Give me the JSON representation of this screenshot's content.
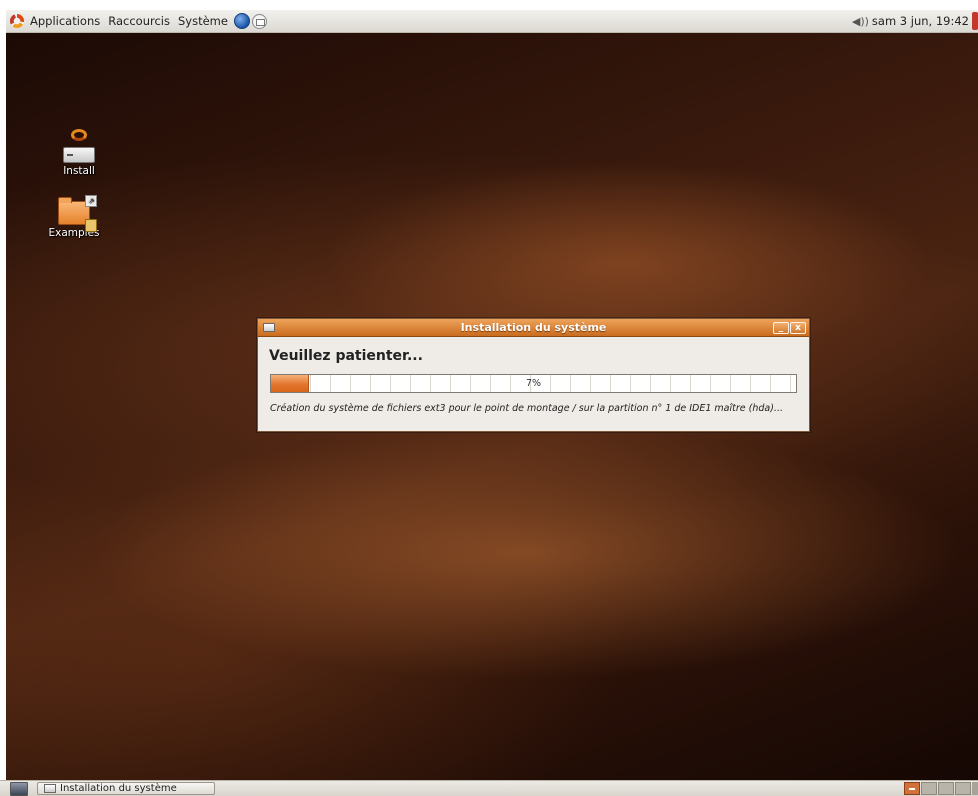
{
  "top_panel": {
    "menus": [
      "Applications",
      "Raccourcis",
      "Système"
    ],
    "clock": "sam  3 jun, 19:42",
    "icons": {
      "logo": "ubuntu-logo-icon",
      "browser": "globe-icon",
      "mail": "mail-icon",
      "volume": "volume-icon"
    }
  },
  "desktop": {
    "icons": [
      {
        "label": "Install",
        "icon": "installer-drive-icon"
      },
      {
        "label": "Examples",
        "icon": "folder-icon"
      }
    ]
  },
  "dialog": {
    "title": "Installation du système",
    "heading": "Veuillez patienter...",
    "progress_percent": 7,
    "progress_text": "7%",
    "status": "Création du système de fichiers ext3 pour le point de montage / sur la partition n° 1 de IDE1 maître (hda)...",
    "buttons": {
      "minimize": "_",
      "close": "x"
    }
  },
  "bottom_panel": {
    "task": "Installation du système",
    "workspaces": 4,
    "active_workspace": 1
  },
  "colors": {
    "accent": "#d9651a",
    "panel": "#e4e1da",
    "dialog_bg": "#efebe7"
  }
}
